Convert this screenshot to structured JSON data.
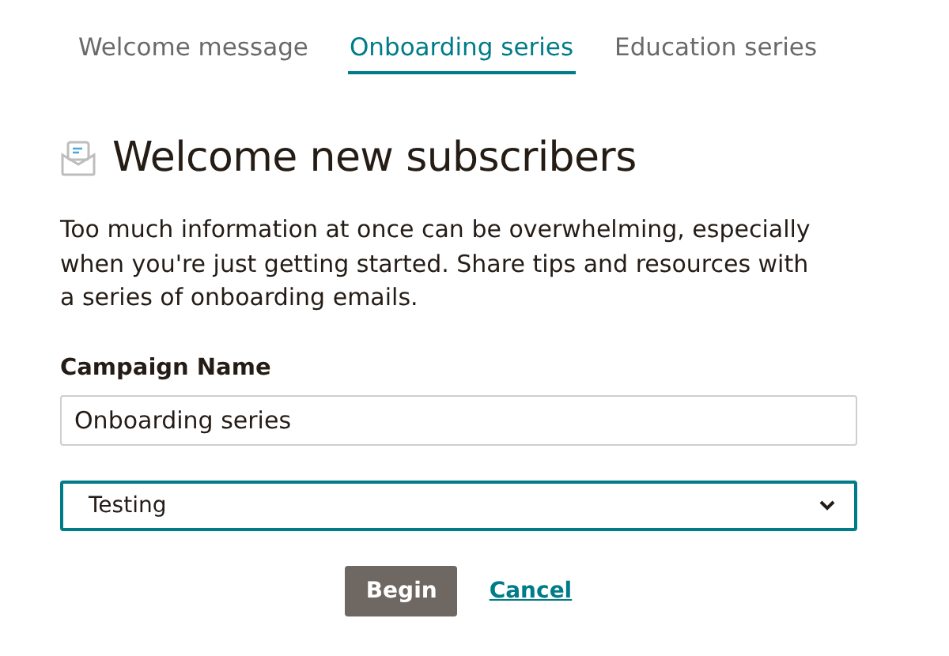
{
  "tabs": [
    {
      "label": "Welcome message",
      "selected": false
    },
    {
      "label": "Onboarding series",
      "selected": true
    },
    {
      "label": "Education series",
      "selected": false
    }
  ],
  "heading": "Welcome new subscribers",
  "description": "Too much information at once can be overwhelming, especially when you're just getting started. Share tips and resources with a series of onboarding emails.",
  "campaign_name": {
    "label": "Campaign Name",
    "value": "Onboarding series"
  },
  "list_select": {
    "value": "Testing"
  },
  "buttons": {
    "primary": "Begin",
    "cancel": "Cancel"
  }
}
